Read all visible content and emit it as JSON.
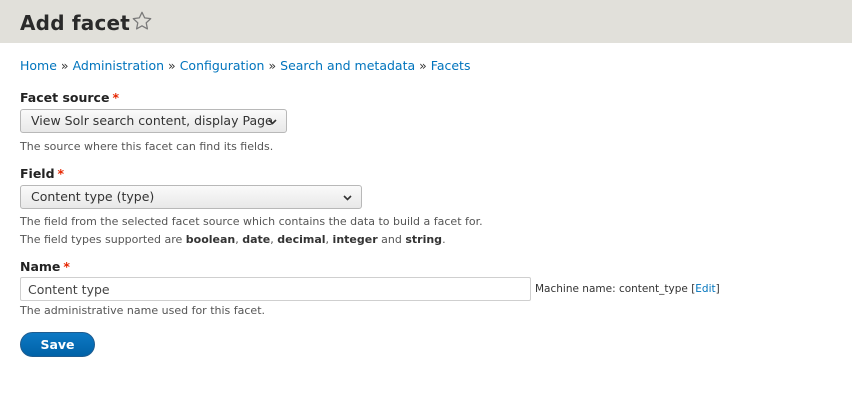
{
  "header": {
    "title": "Add facet",
    "shortcut_icon": "star-outline-icon"
  },
  "breadcrumb": {
    "items": [
      "Home",
      "Administration",
      "Configuration",
      "Search and metadata",
      "Facets"
    ],
    "separator": "»"
  },
  "form": {
    "facet_source": {
      "label": "Facet source",
      "required_mark": "*",
      "selected": "View Solr search content, display Page",
      "description": "The source where this facet can find its fields."
    },
    "field": {
      "label": "Field",
      "required_mark": "*",
      "selected": "Content type (type)",
      "description_1": "The field from the selected facet source which contains the data to build a facet for.",
      "description_2_prefix": "The field types supported are ",
      "types": [
        "boolean",
        "date",
        "decimal",
        "integer",
        "string"
      ],
      "comma": ", ",
      "and": " and ",
      "period": "."
    },
    "name": {
      "label": "Name",
      "required_mark": "*",
      "value": "Content type",
      "machine_name_prefix": "Machine name: content_type ",
      "bracket_open": "[",
      "edit_link": "Edit",
      "bracket_close": "]",
      "description": "The administrative name used for this facet."
    },
    "save_label": "Save"
  },
  "colors": {
    "header_bg": "#e1e0da",
    "link": "#0074bd",
    "required": "#e62600",
    "button_bg": "#0071b8"
  }
}
